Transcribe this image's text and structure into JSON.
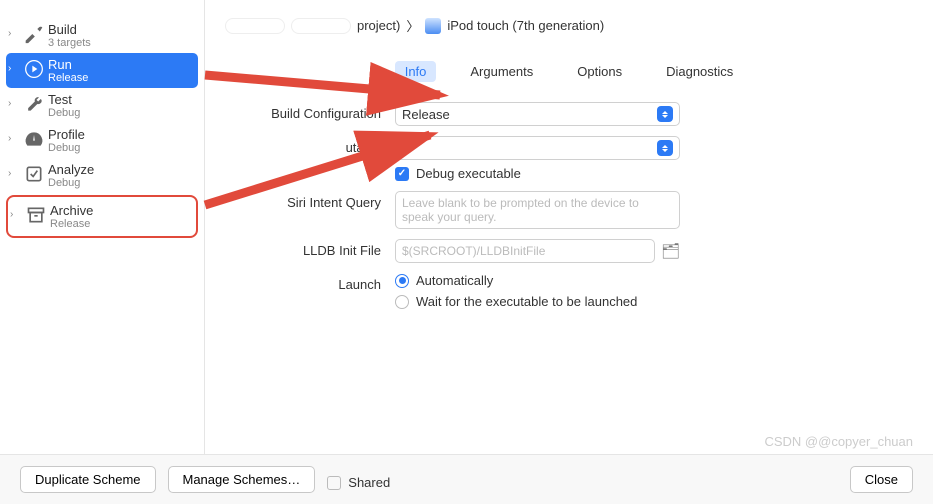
{
  "sidebar": {
    "items": [
      {
        "title": "Build",
        "sub": "3 targets"
      },
      {
        "title": "Run",
        "sub": "Release"
      },
      {
        "title": "Test",
        "sub": "Debug"
      },
      {
        "title": "Profile",
        "sub": "Debug"
      },
      {
        "title": "Analyze",
        "sub": "Debug"
      },
      {
        "title": "Archive",
        "sub": "Release"
      }
    ]
  },
  "breadcrumb": {
    "project_suffix": " project)",
    "chevron": "〉",
    "device": "iPod touch (7th generation)"
  },
  "tabs": {
    "info": "Info",
    "arguments": "Arguments",
    "options": "Options",
    "diagnostics": "Diagnostics"
  },
  "form": {
    "build_config_label": "Build Configuration",
    "build_config_value": "Release",
    "executable_suffix": "utable",
    "debug_exec": "Debug executable",
    "siri_label": "Siri Intent Query",
    "siri_placeholder": "Leave blank to be prompted on the device to speak your query.",
    "lldb_label": "LLDB Init File",
    "lldb_placeholder": "$(SRCROOT)/LLDBInitFile",
    "launch_label": "Launch",
    "launch_auto": "Automatically",
    "launch_wait": "Wait for the executable to be launched"
  },
  "footer": {
    "duplicate": "Duplicate Scheme",
    "manage": "Manage Schemes…",
    "shared": "Shared",
    "close": "Close"
  },
  "watermark": "CSDN @@copyer_chuan"
}
